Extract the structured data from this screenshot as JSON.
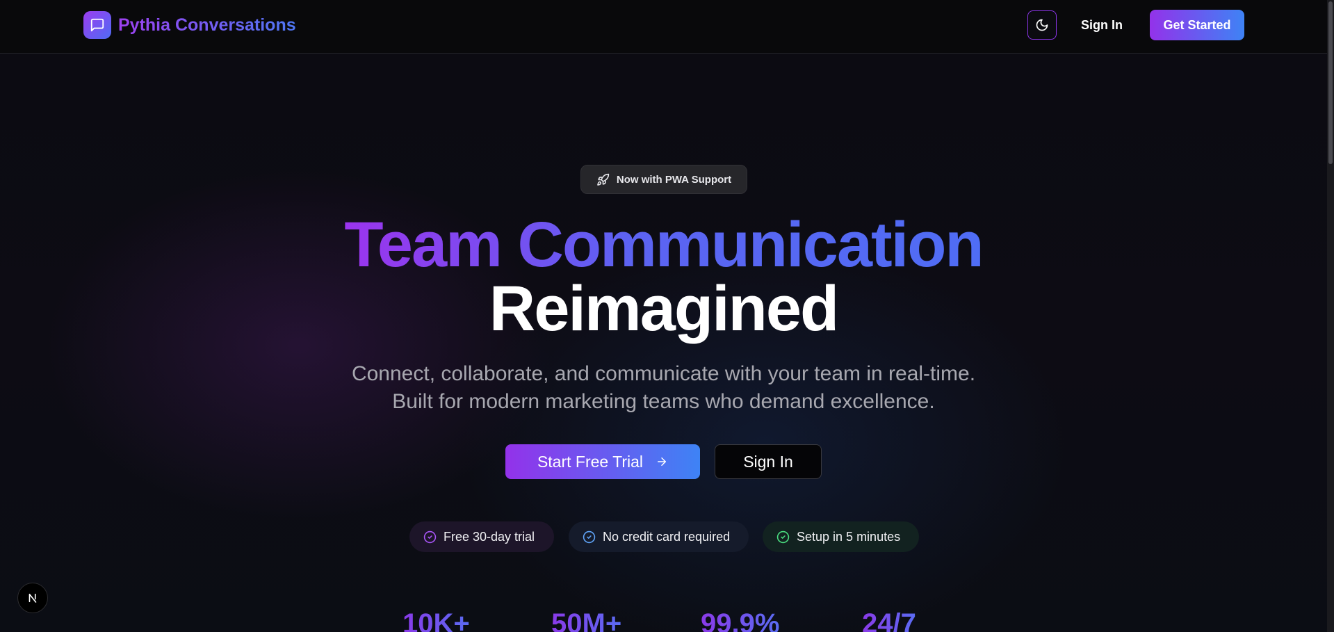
{
  "header": {
    "brand": "Pythia Conversations",
    "theme_toggle_icon": "moon-icon",
    "sign_in": "Sign In",
    "get_started": "Get Started"
  },
  "hero": {
    "badge": "Now with PWA Support",
    "title_gradient": "Team Communication",
    "title_plain": "Reimagined",
    "subtitle_line1": "Connect, collaborate, and communicate with your team in real-time.",
    "subtitle_line2": "Built for modern marketing teams who demand excellence.",
    "cta_primary": "Start Free Trial",
    "cta_secondary": "Sign In"
  },
  "features": [
    {
      "label": "Free 30-day trial",
      "color": "#a855f7"
    },
    {
      "label": "No credit card required",
      "color": "#60a5fa"
    },
    {
      "label": "Setup in 5 minutes",
      "color": "#4ade80"
    }
  ],
  "stats": [
    "10K+",
    "50M+",
    "99.9%",
    "24/7"
  ],
  "colors": {
    "accent_purple": "#9332ea",
    "accent_blue": "#3e83f5",
    "background": "#0a0a0d"
  }
}
